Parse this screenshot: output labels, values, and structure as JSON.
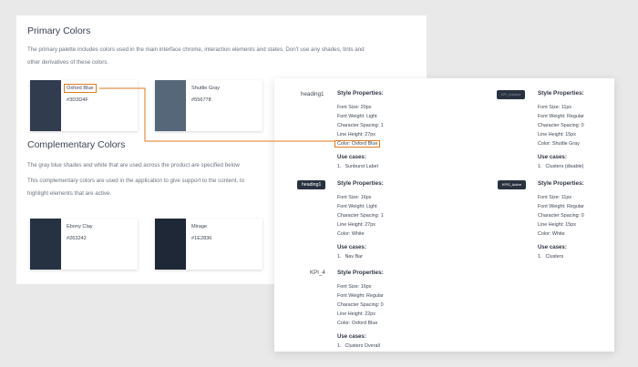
{
  "primary": {
    "title": "Primary Colors",
    "description_line1": "The primary palette includes colors used in the main interface chrome, interaction elements and states. Don't use any shades, tints and",
    "description_line2": "other derivatives of these colors.",
    "swatches": [
      {
        "name": "Oxford Blue",
        "hex": "#3D3D4F",
        "color": "#313c4f"
      },
      {
        "name": "Shuttle Gray",
        "hex": "#556778",
        "color": "#556778"
      }
    ]
  },
  "complementary": {
    "title": "Complementary Colors",
    "description_line1": "The gray blue shades and white that are used across the product are specified below",
    "description_line2": "This complementary colors are used in the application to give support to the content, to",
    "description_line3": "highlight elements that are active.",
    "swatches": [
      {
        "name": "Ebony Clay",
        "hex": "#263242",
        "color": "#263242"
      },
      {
        "name": "Mirage",
        "hex": "#1E2836",
        "color": "#1e2836"
      }
    ]
  },
  "typography": {
    "styles": [
      {
        "label": "heading1",
        "heading": "Style Properties:",
        "props": [
          "Font Size: 20px",
          "Font Weight: Light",
          "Character Spacing: 1",
          "Line Height: 27px",
          "Color: Oxford Blue"
        ],
        "use_cases_title": "Use cases:",
        "use_cases": [
          {
            "num": "1.",
            "text": "Sunburst Label"
          }
        ]
      },
      {
        "label": "KPI_Inactive",
        "heading": "Style Properties:",
        "props": [
          "Font Size: 11px",
          "Font Weight: Regular",
          "Character Spacing: 0",
          "Line Height: 15px",
          "Color: Shuttle Gray"
        ],
        "use_cases_title": "Use cases:",
        "use_cases": [
          {
            "num": "1.",
            "text": "Clusters (disable)"
          }
        ]
      },
      {
        "label": "heading1",
        "heading": "Style Properties:",
        "props": [
          "Font Size: 16px",
          "Font Weight: Light",
          "Character Spacing: 1",
          "Line Height: 27px",
          "Color: White"
        ],
        "use_cases_title": "Use cases:",
        "use_cases": [
          {
            "num": "1.",
            "text": "Nav Bar"
          }
        ]
      },
      {
        "label": "KPIS_Active",
        "heading": "Style Properties:",
        "props": [
          "Font Size: 11px",
          "Font Weight: Regular",
          "Character Spacing: 0",
          "Line Height: 15px",
          "Color: White"
        ],
        "use_cases_title": "Use cases:",
        "use_cases": [
          {
            "num": "1.",
            "text": "Clusters"
          }
        ]
      },
      {
        "label": "KPI_4",
        "heading": "Style Properties:",
        "props": [
          "Font Size: 16px",
          "Font Weight: Regular",
          "Character Spacing: 0",
          "Line Height: 22px",
          "Color: Oxford Blue"
        ],
        "use_cases_title": "Use cases:",
        "use_cases": [
          {
            "num": "1.",
            "text": "Clusters Overall"
          }
        ]
      }
    ]
  },
  "colors": {
    "accent_line": "#e07a1f",
    "tag_bg": "#2a3240"
  }
}
